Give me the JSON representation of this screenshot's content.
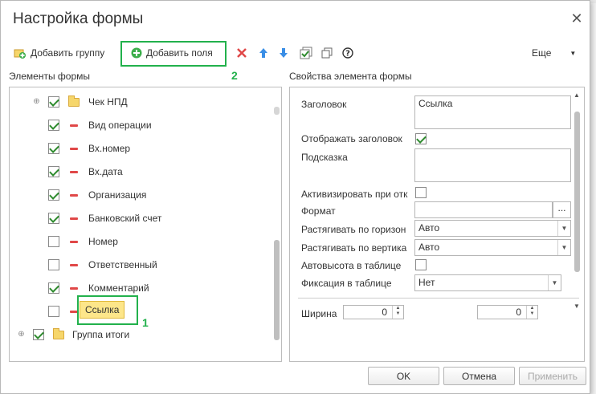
{
  "dialog": {
    "title": "Настройка формы"
  },
  "toolbar": {
    "add_group_label": "Добавить группу",
    "add_fields_label": "Добавить поля",
    "more_label": "Еще"
  },
  "left_panel": {
    "label": "Элементы формы",
    "items": [
      {
        "label": "Чек НПД",
        "checked": true,
        "kind": "group"
      },
      {
        "label": "Вид операции",
        "checked": true,
        "kind": "field"
      },
      {
        "label": "Вх.номер",
        "checked": true,
        "kind": "field"
      },
      {
        "label": "Вх.дата",
        "checked": true,
        "kind": "field"
      },
      {
        "label": "Организация",
        "checked": true,
        "kind": "field"
      },
      {
        "label": "Банковский счет",
        "checked": true,
        "kind": "field"
      },
      {
        "label": "Номер",
        "checked": false,
        "kind": "field"
      },
      {
        "label": "Ответственный",
        "checked": false,
        "kind": "field"
      },
      {
        "label": "Комментарий",
        "checked": true,
        "kind": "field"
      },
      {
        "label": "Ссылка",
        "checked": false,
        "kind": "field",
        "selected": true
      },
      {
        "label": "Группа итоги",
        "checked": true,
        "kind": "group"
      }
    ]
  },
  "right_panel": {
    "label": "Свойства элемента формы",
    "header_label": "Заголовок",
    "header_value": "Ссылка",
    "show_header_label": "Отображать заголовок",
    "show_header_checked": true,
    "tooltip_label": "Подсказка",
    "tooltip_value": "",
    "activate_label": "Активизировать при отк",
    "activate_checked": false,
    "format_label": "Формат",
    "format_button": "...",
    "stretch_h_label": "Растягивать по горизон",
    "stretch_h_value": "Авто",
    "stretch_v_label": "Растягивать по вертика",
    "stretch_v_value": "Авто",
    "autoheight_label": "Автовысота в таблице",
    "autoheight_checked": false,
    "fix_label": "Фиксация в таблице",
    "fix_value": "Нет",
    "width_label": "Ширина",
    "width_value": "0",
    "height_value": "0"
  },
  "annotations": {
    "one": "1",
    "two": "2"
  },
  "buttons": {
    "ok": "OK",
    "cancel": "Отмена",
    "apply": "Применить"
  },
  "colors": {
    "highlight": "#22b14c",
    "selection": "#fde68a",
    "check": "#2e8b2e",
    "delete_red": "#e04848",
    "arrow_blue": "#3a8ee6"
  },
  "icons": {
    "add_group": "add-group-icon",
    "add_fields": "green-plus-icon",
    "delete": "red-x-icon",
    "move_up": "blue-up-arrow-icon",
    "move_down": "blue-down-arrow-icon",
    "check_all": "checkbox-list-icon",
    "copy": "copy-icon",
    "help": "help-icon",
    "more": "dropdown-arrow-icon",
    "close": "close-icon"
  }
}
